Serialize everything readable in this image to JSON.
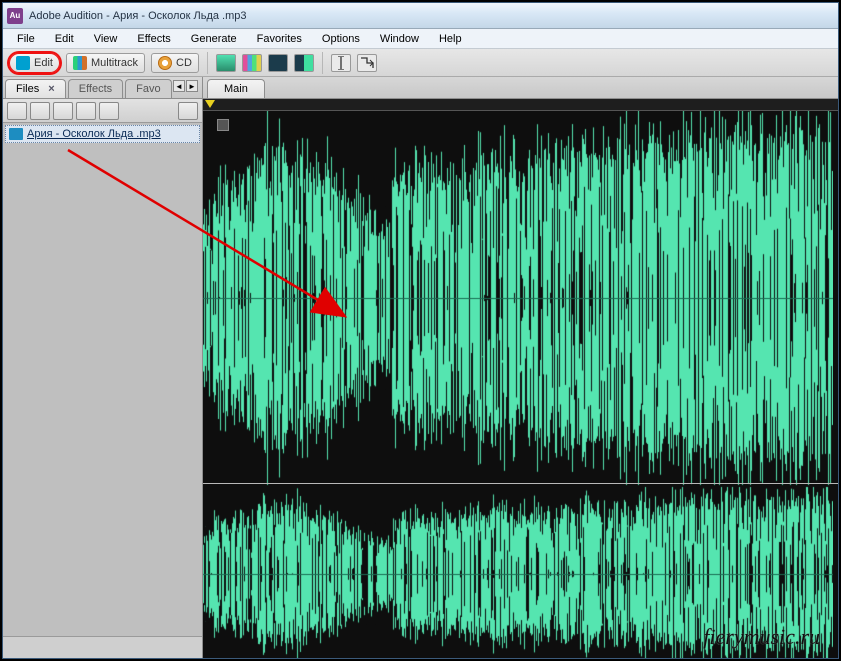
{
  "title": "Adobe Audition - Ария - Осколок Льда .mp3",
  "app_icon_text": "Au",
  "menu": {
    "file": "File",
    "edit": "Edit",
    "view": "View",
    "effects": "Effects",
    "generate": "Generate",
    "favorites": "Favorites",
    "options": "Options",
    "window": "Window",
    "help": "Help"
  },
  "modes": {
    "edit": "Edit",
    "multitrack": "Multitrack",
    "cd": "CD"
  },
  "side_tabs": {
    "files": "Files",
    "effects": "Effects",
    "favorites": "Favo"
  },
  "file_item": "Ария - Осколок Льда .mp3",
  "main_tab": "Main",
  "watermark": "fierymusic.ru"
}
